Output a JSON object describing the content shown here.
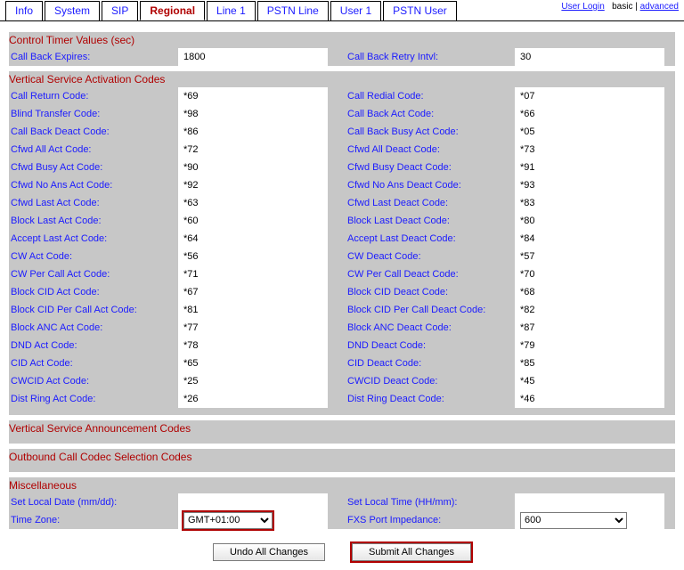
{
  "toplinks": {
    "login": "User Login",
    "basic": "basic",
    "sep": " | ",
    "advanced": "advanced"
  },
  "tabs": [
    "Info",
    "System",
    "SIP",
    "Regional",
    "Line 1",
    "PSTN Line",
    "User 1",
    "PSTN User"
  ],
  "active_tab": 3,
  "sections": {
    "ctr": "Control Timer Values (sec)",
    "vsac": "Vertical Service Activation Codes",
    "vsan": "Vertical Service Announcement Codes",
    "occ": "Outbound Call Codec Selection Codes",
    "misc": "Miscellaneous"
  },
  "rows_ctr": [
    {
      "l1": "Call Back Expires:",
      "v1": "1800",
      "l2": "Call Back Retry Intvl:",
      "v2": "30"
    }
  ],
  "rows_vsac": [
    {
      "l1": "Call Return Code:",
      "v1": "*69",
      "l2": "Call Redial Code:",
      "v2": "*07"
    },
    {
      "l1": "Blind Transfer Code:",
      "v1": "*98",
      "l2": "Call Back Act Code:",
      "v2": "*66"
    },
    {
      "l1": "Call Back Deact Code:",
      "v1": "*86",
      "l2": "Call Back Busy Act Code:",
      "v2": "*05"
    },
    {
      "l1": "Cfwd All Act Code:",
      "v1": "*72",
      "l2": "Cfwd All Deact Code:",
      "v2": "*73"
    },
    {
      "l1": "Cfwd Busy Act Code:",
      "v1": "*90",
      "l2": "Cfwd Busy Deact Code:",
      "v2": "*91"
    },
    {
      "l1": "Cfwd No Ans Act Code:",
      "v1": "*92",
      "l2": "Cfwd No Ans Deact Code:",
      "v2": "*93"
    },
    {
      "l1": "Cfwd Last Act Code:",
      "v1": "*63",
      "l2": "Cfwd Last Deact Code:",
      "v2": "*83"
    },
    {
      "l1": "Block Last Act Code:",
      "v1": "*60",
      "l2": "Block Last Deact Code:",
      "v2": "*80"
    },
    {
      "l1": "Accept Last Act Code:",
      "v1": "*64",
      "l2": "Accept Last Deact Code:",
      "v2": "*84"
    },
    {
      "l1": "CW Act Code:",
      "v1": "*56",
      "l2": "CW Deact Code:",
      "v2": "*57"
    },
    {
      "l1": "CW Per Call Act Code:",
      "v1": "*71",
      "l2": "CW Per Call Deact Code:",
      "v2": "*70"
    },
    {
      "l1": "Block CID Act Code:",
      "v1": "*67",
      "l2": "Block CID Deact Code:",
      "v2": "*68"
    },
    {
      "l1": "Block CID Per Call Act Code:",
      "v1": "*81",
      "l2": "Block CID Per Call Deact Code:",
      "v2": "*82"
    },
    {
      "l1": "Block ANC Act Code:",
      "v1": "*77",
      "l2": "Block ANC Deact Code:",
      "v2": "*87"
    },
    {
      "l1": "DND Act Code:",
      "v1": "*78",
      "l2": "DND Deact Code:",
      "v2": "*79"
    },
    {
      "l1": "CID Act Code:",
      "v1": "*65",
      "l2": "CID Deact Code:",
      "v2": "*85"
    },
    {
      "l1": "CWCID Act Code:",
      "v1": "*25",
      "l2": "CWCID Deact Code:",
      "v2": "*45"
    },
    {
      "l1": "Dist Ring Act Code:",
      "v1": "*26",
      "l2": "Dist Ring Deact Code:",
      "v2": "*46"
    }
  ],
  "rows_misc": [
    {
      "l1": "Set Local Date (mm/dd):",
      "v1": "",
      "l2": "Set Local Time (HH/mm):",
      "v2": ""
    }
  ],
  "rows_misc2": {
    "l1": "Time Zone:",
    "v1": "GMT+01:00",
    "l2": "FXS Port Impedance:",
    "v2": "600"
  },
  "buttons": {
    "undo": "Undo All Changes",
    "submit": "Submit All Changes"
  }
}
